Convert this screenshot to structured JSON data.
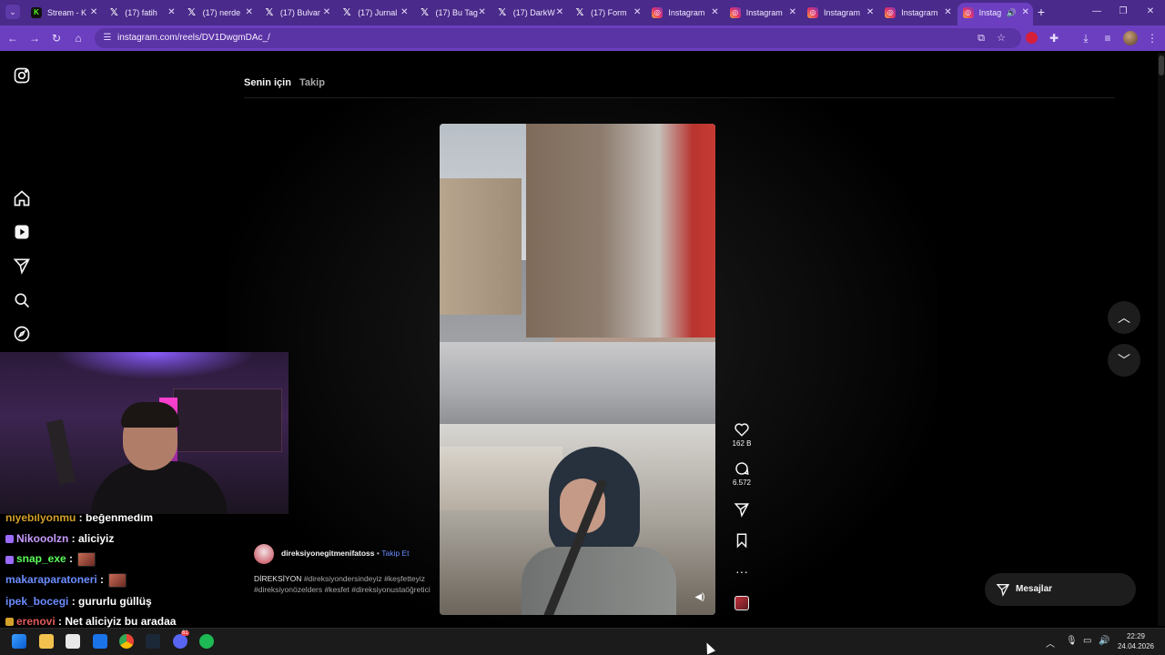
{
  "browser": {
    "tabs": [
      {
        "title": "Stream - K",
        "favicon": "kick-icon",
        "active": false
      },
      {
        "title": "(17) fatih",
        "favicon": "x-icon",
        "active": false
      },
      {
        "title": "(17) nerde",
        "favicon": "x-icon",
        "active": false
      },
      {
        "title": "(17) Bulvar",
        "favicon": "x-icon",
        "active": false
      },
      {
        "title": "(17) Jurnal",
        "favicon": "x-icon",
        "active": false
      },
      {
        "title": "(17) Bu Tag",
        "favicon": "x-icon",
        "active": false
      },
      {
        "title": "(17) DarkW",
        "favicon": "x-icon",
        "active": false
      },
      {
        "title": "(17) Form",
        "favicon": "x-icon",
        "active": false
      },
      {
        "title": "Instagram",
        "favicon": "instagram-icon",
        "active": false
      },
      {
        "title": "Instagram",
        "favicon": "instagram-icon",
        "active": false
      },
      {
        "title": "Instagram",
        "favicon": "instagram-icon",
        "active": false
      },
      {
        "title": "Instagram",
        "favicon": "instagram-icon",
        "active": false
      },
      {
        "title": "Instag",
        "favicon": "instagram-icon",
        "active": true
      }
    ],
    "url": "instagram.com/reels/DV1DwgmDAc_/",
    "accent_color": "#6b3fc0"
  },
  "feed": {
    "tab_for_you": "Senin için",
    "tab_following": "Takip"
  },
  "reel": {
    "likes": "162 B",
    "comments": "6.572",
    "username": "direksiyonegitmenifatoss",
    "separator": "•",
    "follow_label": "Takip Et",
    "caption_title": "DİREKSİYON",
    "caption_tags": "#direksiyondersindeyiz #keşfetteyiz #direksiyonözelders #kesfet #direksiyonustaöğretici"
  },
  "messages_label": "Mesajlar",
  "chat": [
    {
      "user": "niyebilyonmu",
      "message": "beğenmedim",
      "color": "#d4a12a"
    },
    {
      "user": "Nikooolzn",
      "message": "aliciyiz",
      "color": "#c79cff"
    },
    {
      "user": "snap_exe",
      "message": "",
      "color": "#5bff5b"
    },
    {
      "user": "makaraparatoneri",
      "message": "",
      "color": "#6b8cff"
    },
    {
      "user": "ipek_bocegi",
      "message": "gururlu güllüş",
      "color": "#6b8cff"
    },
    {
      "user": "erenovi",
      "message": "Net aliciyiz bu aradaa",
      "color": "#e05a5a"
    }
  ],
  "clock": {
    "time": "22:29",
    "date": "24.04.2026"
  },
  "taskbar": {
    "discord_badge": "61"
  }
}
